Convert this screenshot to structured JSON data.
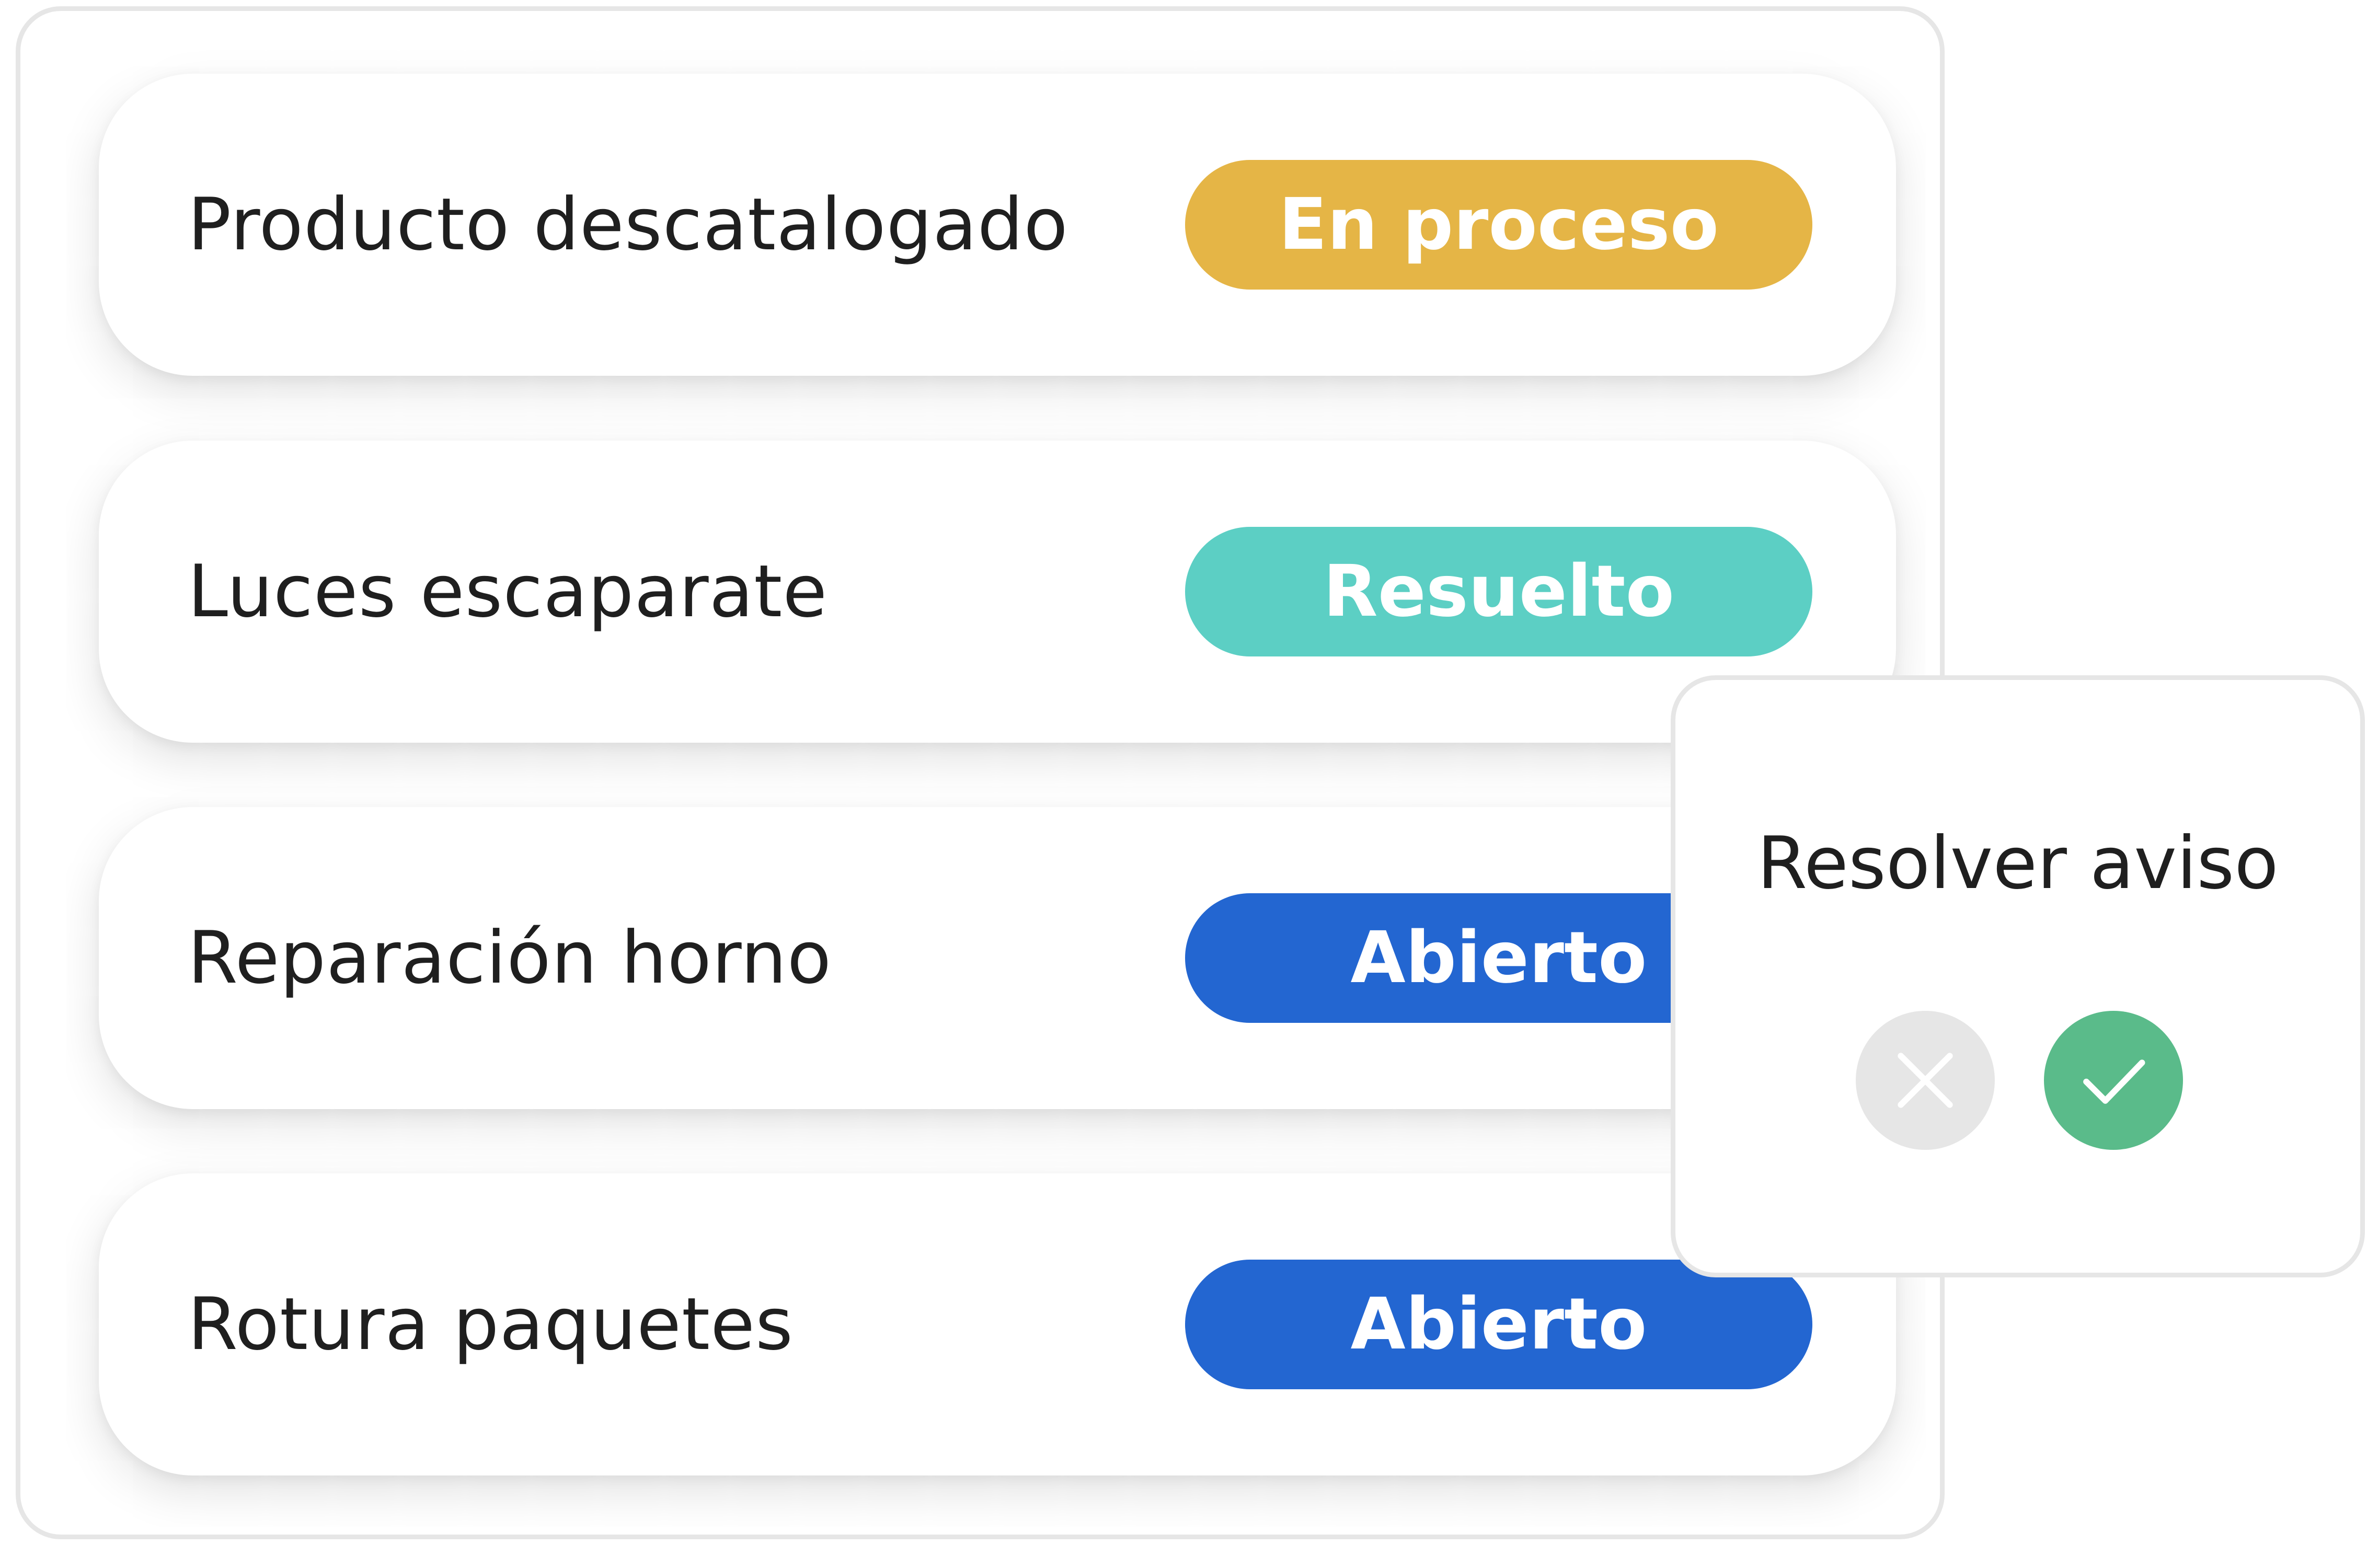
{
  "items": [
    {
      "label": "Producto descatalogado",
      "status": "En proceso",
      "status_color": "#e5b546"
    },
    {
      "label": "Luces escaparate",
      "status": "Resuelto",
      "status_color": "#5ccfc4"
    },
    {
      "label": "Reparación horno",
      "status": "Abierto",
      "status_color": "#2366d1"
    },
    {
      "label": "Rotura paquetes",
      "status": "Abierto",
      "status_color": "#2366d1"
    }
  ],
  "popup": {
    "title": "Resolver aviso",
    "cancel_icon": "close-icon",
    "confirm_icon": "checkmark-icon",
    "cancel_color": "#e6e6e6",
    "confirm_color": "#5abb8a"
  }
}
